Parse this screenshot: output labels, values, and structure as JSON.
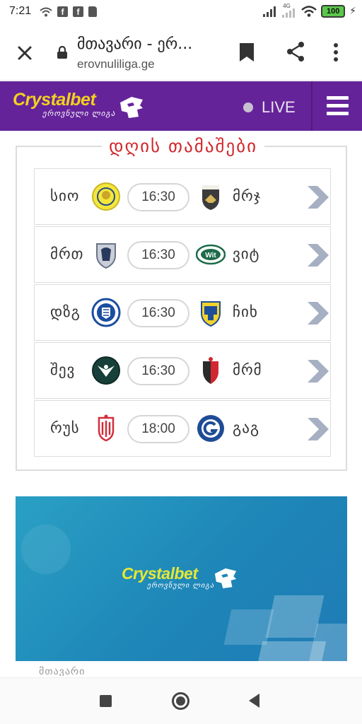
{
  "status_bar": {
    "time": "7:21",
    "network_label": "4G",
    "battery": "100"
  },
  "browser": {
    "page_title": "მთავარი - ერ...",
    "url": "erovnuliliga.ge"
  },
  "site_header": {
    "logo_main": "Crystalbet",
    "logo_sub": "ეროვნული ლიგა",
    "live_label": "LIVE"
  },
  "matches": {
    "title": "დღის თამაშები",
    "rows": [
      {
        "home": "სიო",
        "time": "16:30",
        "away": "მრჯ"
      },
      {
        "home": "მრთ",
        "time": "16:30",
        "away": "ვიტ"
      },
      {
        "home": "დზგ",
        "time": "16:30",
        "away": "ჩიხ"
      },
      {
        "home": "შევ",
        "time": "16:30",
        "away": "მრმ"
      },
      {
        "home": "რუს",
        "time": "18:00",
        "away": "გაგ"
      }
    ]
  },
  "banner": {
    "logo_main": "Crystalbet",
    "logo_sub": "ეროვნული ლიგა"
  },
  "footer_peek": "მთავარი",
  "colors": {
    "header_purple": "#65239a",
    "title_red": "#d1272b",
    "logo_yellow": "#f3d11e",
    "banner_blue": "#1e86b8"
  }
}
